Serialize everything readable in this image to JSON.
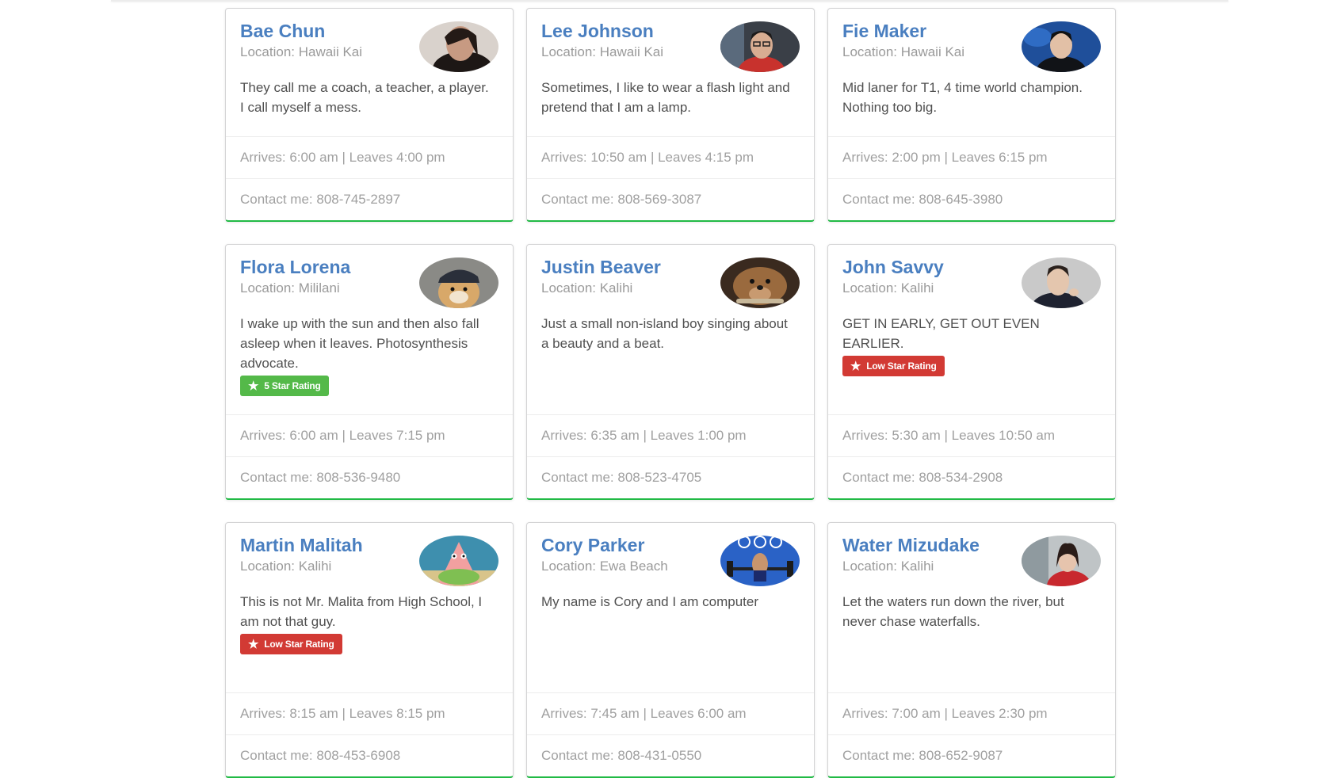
{
  "cards": [
    {
      "name": "Bae Chun",
      "location": "Location: Hawaii Kai",
      "description": "They call me a coach, a teacher, a player. I call myself a mess.",
      "badge": "",
      "times": "Arrives: 6:00 am | Leaves 4:00 pm",
      "contact": "Contact me: 808-745-2897"
    },
    {
      "name": "Lee Johnson",
      "location": "Location: Hawaii Kai",
      "description": "Sometimes, I like to wear a flash light and pretend that I am a lamp.",
      "badge": "",
      "times": "Arrives: 10:50 am | Leaves 4:15 pm",
      "contact": "Contact me: 808-569-3087"
    },
    {
      "name": "Fie Maker",
      "location": "Location: Hawaii Kai",
      "description": "Mid laner for T1, 4 time world champion. Nothing too big.",
      "badge": "",
      "times": "Arrives: 2:00 pm | Leaves 6:15 pm",
      "contact": "Contact me: 808-645-3980"
    },
    {
      "name": "Flora Lorena",
      "location": "Location: Mililani",
      "description": "I wake up with the sun and then also fall asleep when it leaves. Photosynthesis advocate.",
      "badge": "5 Star Rating",
      "badge_color": "#54b949",
      "times": "Arrives: 6:00 am | Leaves 7:15 pm",
      "contact": "Contact me: 808-536-9480"
    },
    {
      "name": "Justin Beaver",
      "location": "Location: Kalihi",
      "description": "Just a small non-island boy singing about a beauty and a beat.",
      "badge": "",
      "times": "Arrives: 6:35 am | Leaves 1:00 pm",
      "contact": "Contact me: 808-523-4705"
    },
    {
      "name": "John Savvy",
      "location": "Location: Kalihi",
      "description": "GET IN EARLY, GET OUT EVEN EARLIER.",
      "badge": "Low Star Rating",
      "badge_color": "#d23a34",
      "times": "Arrives: 5:30 am | Leaves 10:50 am",
      "contact": "Contact me: 808-534-2908"
    },
    {
      "name": "Martin Malitah",
      "location": "Location: Kalihi",
      "description": "This is not Mr. Malita from High School, I am not that guy.",
      "badge": "Low Star Rating",
      "badge_color": "#d23a34",
      "times": "Arrives: 8:15 am | Leaves 8:15 pm",
      "contact": "Contact me: 808-453-6908"
    },
    {
      "name": "Cory Parker",
      "location": "Location: Ewa Beach",
      "description": "My name is Cory and I am computer",
      "badge": "",
      "times": "Arrives: 7:45 am | Leaves 6:00 am",
      "contact": "Contact me: 808-431-0550"
    },
    {
      "name": "Water Mizudake",
      "location": "Location: Kalihi",
      "description": "Let the waters run down the river, but never chase waterfalls.",
      "badge": "",
      "times": "Arrives: 7:00 am | Leaves 2:30 pm",
      "contact": "Contact me: 808-652-9087"
    }
  ],
  "colors": {
    "name": "#4a7fc0",
    "card_accent": "#21ba45",
    "badge_green": "#54b949",
    "badge_red": "#d23a34"
  },
  "icons": {
    "badge_icon": "star-icon"
  }
}
